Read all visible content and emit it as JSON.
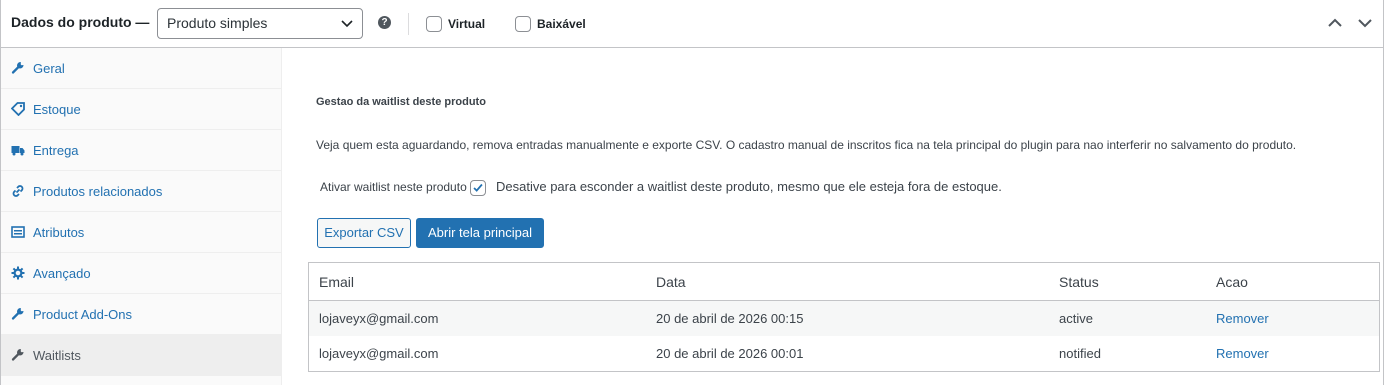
{
  "header": {
    "title": "Dados do produto —",
    "product_type": "Produto simples",
    "help_icon": "question-icon",
    "virtual_label": "Virtual",
    "downloadable_label": "Baixável",
    "virtual_checked": false,
    "downloadable_checked": false
  },
  "sidebar": {
    "items": [
      {
        "label": "Geral",
        "icon": "wrench-icon",
        "active": false
      },
      {
        "label": "Estoque",
        "icon": "tag-icon",
        "active": false
      },
      {
        "label": "Entrega",
        "icon": "truck-icon",
        "active": false
      },
      {
        "label": "Produtos relacionados",
        "icon": "link-icon",
        "active": false
      },
      {
        "label": "Atributos",
        "icon": "list-icon",
        "active": false
      },
      {
        "label": "Avançado",
        "icon": "gear-icon",
        "active": false
      },
      {
        "label": "Product Add-Ons",
        "icon": "wrench-icon",
        "active": false
      },
      {
        "label": "Waitlists",
        "icon": "wrench-icon",
        "active": true
      }
    ]
  },
  "main": {
    "title": "Gestao da waitlist deste produto",
    "description": "Veja quem esta aguardando, remova entradas manualmente e exporte CSV. O cadastro manual de inscritos fica na tela principal do plugin para nao interferir no salvamento do produto.",
    "enable_label": "Ativar waitlist neste produto",
    "enable_checked": true,
    "enable_description": "Desative para esconder a waitlist deste produto, mesmo que ele esteja fora de estoque.",
    "export_button": "Exportar CSV",
    "open_button": "Abrir tela principal",
    "table": {
      "headers": [
        "Email",
        "Data",
        "Status",
        "Acao"
      ],
      "rows": [
        {
          "email": "lojaveyx@gmail.com",
          "date": "20 de abril de 2026 00:15",
          "status": "active",
          "action": "Remover"
        },
        {
          "email": "lojaveyx@gmail.com",
          "date": "20 de abril de 2026 00:01",
          "status": "notified",
          "action": "Remover"
        }
      ]
    }
  },
  "colors": {
    "accent": "#2271b1",
    "text": "#1d2327",
    "border": "#c3c4c7"
  }
}
